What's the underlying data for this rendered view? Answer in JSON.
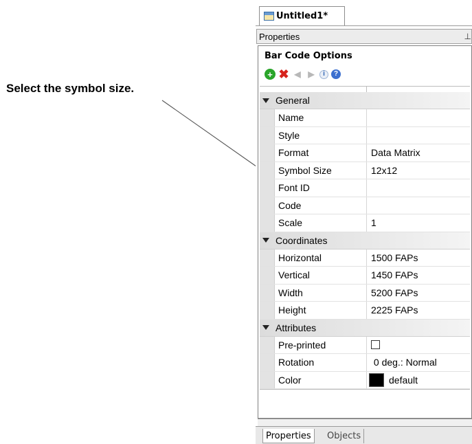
{
  "callout": {
    "text": "Select the symbol size."
  },
  "document_tab": {
    "label": "Untitled1*"
  },
  "properties_header": {
    "title": "Properties",
    "pin_glyph": "⊥"
  },
  "panel": {
    "title": "Bar Code Options",
    "toolbar_icons": [
      "add-icon",
      "delete-icon",
      "previous-icon",
      "next-icon",
      "info-icon",
      "help-icon"
    ]
  },
  "grid": {
    "categories": [
      {
        "name": "General",
        "rows": [
          {
            "name": "Name",
            "value": ""
          },
          {
            "name": "Style",
            "value": ""
          },
          {
            "name": "Format",
            "value": "Data Matrix"
          },
          {
            "name": "Symbol Size",
            "value": "12x12"
          },
          {
            "name": "Font ID",
            "value": ""
          },
          {
            "name": "Code",
            "value": ""
          },
          {
            "name": "Scale",
            "value": "1"
          }
        ]
      },
      {
        "name": "Coordinates",
        "rows": [
          {
            "name": "Horizontal",
            "value": "1500 FAPs"
          },
          {
            "name": "Vertical",
            "value": "1450 FAPs"
          },
          {
            "name": "Width",
            "value": "5200 FAPs"
          },
          {
            "name": "Height",
            "value": "2225 FAPs"
          }
        ]
      },
      {
        "name": "Attributes",
        "rows": [
          {
            "name": "Pre-printed",
            "value": "",
            "control": "checkbox",
            "checked": false
          },
          {
            "name": "Rotation",
            "value": " 0 deg.: Normal"
          },
          {
            "name": "Color",
            "value": "default",
            "control": "color-swatch",
            "color": "#000000"
          }
        ]
      }
    ]
  },
  "bottom_tabs": {
    "properties": "Properties",
    "objects": "Objects"
  }
}
